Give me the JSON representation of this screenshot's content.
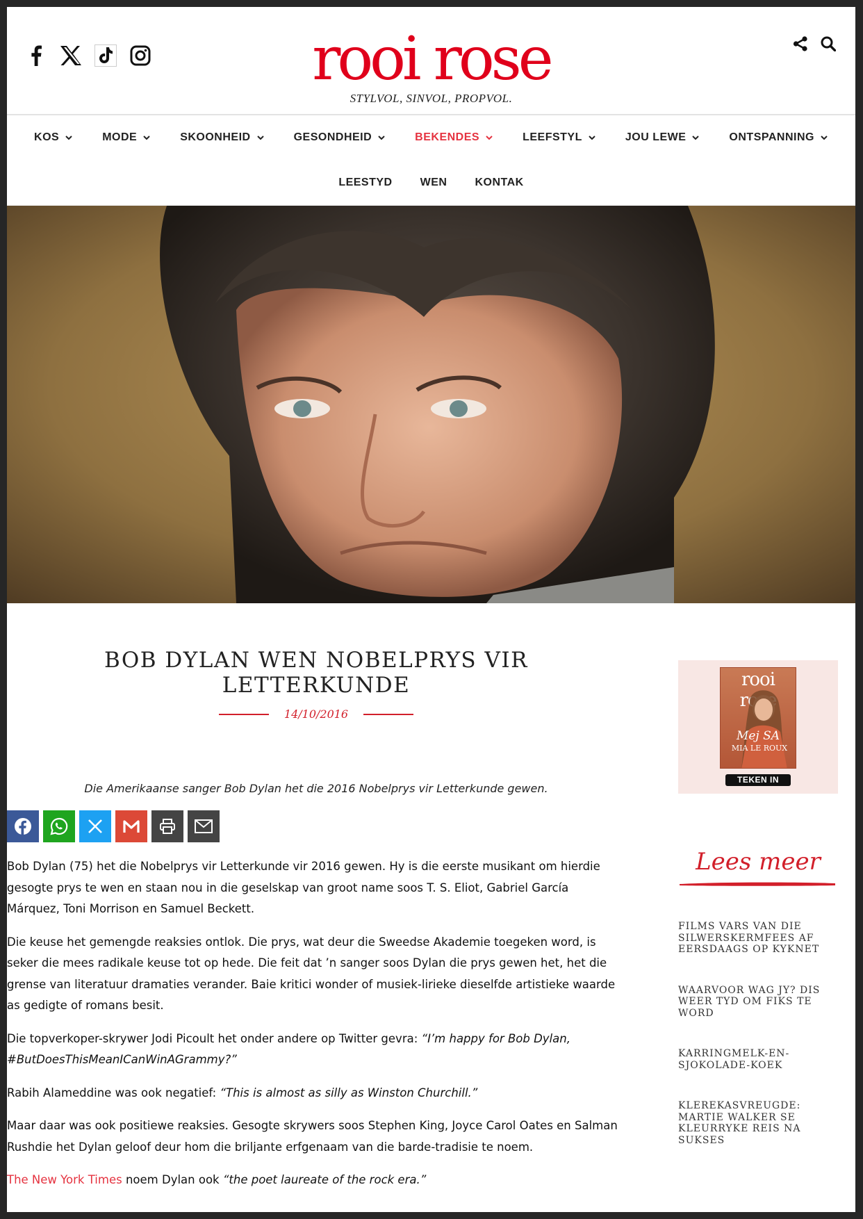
{
  "brand": {
    "logo": "rooi rose",
    "tagline": "STYLVOL, SINVOL, PROPVOL.",
    "accent": "#e0001b"
  },
  "social": [
    "facebook-icon",
    "x-icon",
    "tiktok-icon",
    "instagram-icon"
  ],
  "header_tools": [
    "share-icon",
    "search-icon"
  ],
  "nav": {
    "row1": [
      {
        "label": "KOS",
        "active": false
      },
      {
        "label": "MODE",
        "active": false
      },
      {
        "label": "SKOONHEID",
        "active": false
      },
      {
        "label": "GESONDHEID",
        "active": false
      },
      {
        "label": "BEKENDES",
        "active": true
      },
      {
        "label": "LEEFSTYL",
        "active": false
      },
      {
        "label": "JOU LEWE",
        "active": false
      },
      {
        "label": "ONTSPANNING",
        "active": false
      }
    ],
    "row2": [
      {
        "label": "LEESTYD"
      },
      {
        "label": "WEN"
      },
      {
        "label": "KONTAK"
      }
    ]
  },
  "article": {
    "title": "BOB DYLAN WEN NOBELPRYS VIR LETTERKUNDE",
    "date": "14/10/2016",
    "caption": "Die Amerikaanse sanger Bob Dylan het die 2016 Nobelprys vir Letterkunde gewen.",
    "share_buttons": [
      {
        "icon": "facebook-icon",
        "color": "#3b5998"
      },
      {
        "icon": "whatsapp-icon",
        "color": "#1fa51f"
      },
      {
        "icon": "x-icon",
        "color": "#1da1f2"
      },
      {
        "icon": "gmail-icon",
        "color": "#dc4937"
      },
      {
        "icon": "print-icon",
        "color": "#444444"
      },
      {
        "icon": "email-icon",
        "color": "#444444"
      }
    ],
    "p1": "Bob Dylan (75) het die Nobelprys vir Letterkunde vir 2016 gewen. Hy is die eerste musikant om hierdie gesogte prys te wen en staan nou in die geselskap van groot name soos T. S. Eliot, Gabriel García Márquez, Toni Morrison en Samuel Beckett.",
    "p2": "Die keuse het gemengde reaksies ontlok. Die prys, wat deur die Sweedse Akademie toegeken word, is seker die mees radikale keuse tot op hede. Die feit dat ’n sanger soos Dylan die prys gewen het, het die grense van literatuur dramaties verander. Baie kritici wonder of musiek-lirieke dieselfde artistieke waarde as gedigte of romans besit.",
    "p3_lead": "Die topverkoper-skrywer Jodi Picoult het onder andere op Twitter gevra: ",
    "p3_quote": "“I’m happy for Bob Dylan, #ButDoesThisMeanICanWinAGrammy?”",
    "p4_lead": "Rabih Alameddine was ook negatief: ",
    "p4_quote": "“This is almost as silly as Winston Churchill.”",
    "p5": "Maar daar was ook positiewe reaksies. Gesogte skrywers soos Stephen King, Joyce Carol Oates en Salman Rushdie het Dylan geloof deur hom die briljante erfgenaam van die barde-tradisie te noem.",
    "p6_link": "The New York Times",
    "p6_mid": " noem Dylan ook ",
    "p6_quote": "“the poet laureate of the rock era.”"
  },
  "sidebar": {
    "promo": {
      "cover_logo": "rooi rose",
      "cover_kicker": "Mej SA",
      "cover_name": "MIA LE ROUX",
      "button": "TEKEN IN"
    },
    "heading": "Lees meer",
    "related": [
      "FILMS VARS VAN DIE SILWERSKERMFEES AF EERSDAAGS OP KYKNET",
      "WAARVOOR WAG JY? DIS WEER TYD OM FIKS TE WORD",
      "KARRINGMELK-EN-SJOKOLADE-KOEK",
      "KLEREKASVREUGDE: MARTIE WALKER SE KLEURRYKE REIS NA SUKSES"
    ]
  }
}
